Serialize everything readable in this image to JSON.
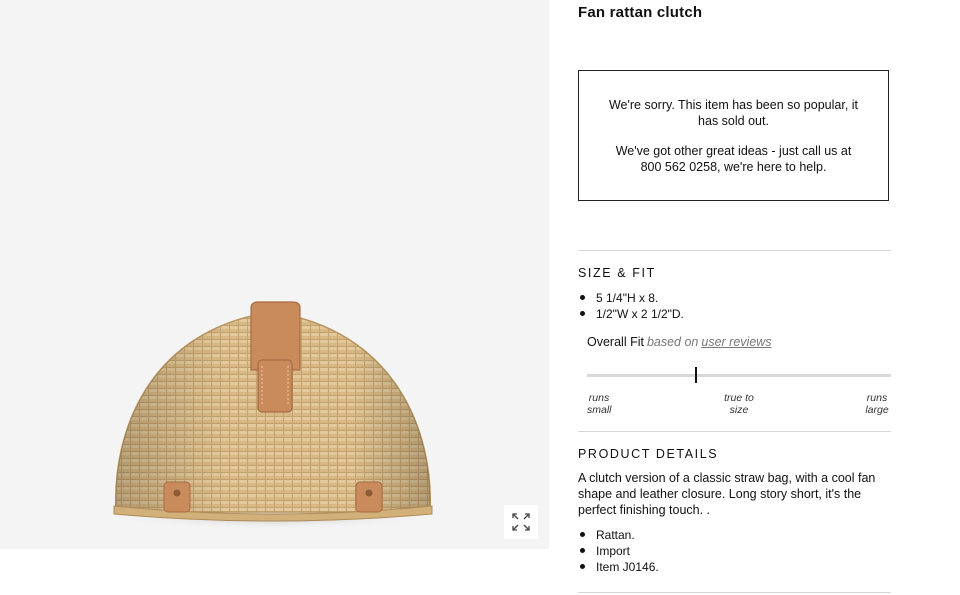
{
  "product": {
    "title": "Fan rattan clutch",
    "image_alt": "Fan-shaped rattan clutch with tan leather tab closure",
    "zoom_icon": "expand-arrows-icon"
  },
  "soldout": {
    "message": "We're sorry. This item has been so popular, it has sold out.",
    "help": "We've got other great ideas - just call us at 800 562 0258, we're here to help."
  },
  "size_fit": {
    "heading": "SIZE & FIT",
    "bullets": [
      "5 1/4\"H x 8.",
      "1/2\"W x 2 1/2\"D."
    ],
    "overall_fit_label": "Overall Fit",
    "based_on": "based on",
    "user_reviews": "user reviews",
    "scale_left": "runs small",
    "scale_center": "true to size",
    "scale_right": "runs large",
    "fit_position_fraction": 0.36
  },
  "product_details": {
    "heading": "PRODUCT DETAILS",
    "description": "A clutch version of a classic straw bag, with a cool fan shape and leather closure. Long story short, it's the perfect finishing touch. .",
    "bullets": [
      "Rattan.",
      "Import",
      "Item J0146."
    ]
  }
}
